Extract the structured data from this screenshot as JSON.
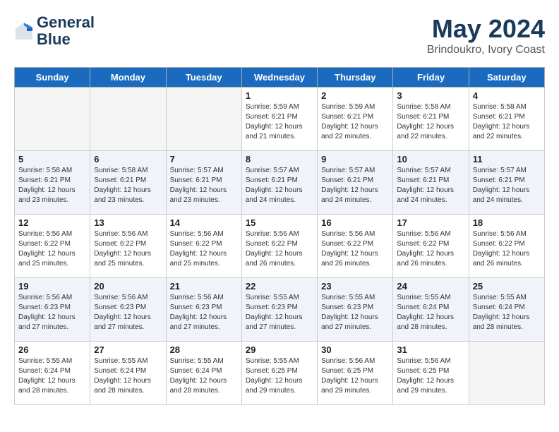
{
  "header": {
    "logo_line1": "General",
    "logo_line2": "Blue",
    "month_year": "May 2024",
    "location": "Brindoukro, Ivory Coast"
  },
  "days_of_week": [
    "Sunday",
    "Monday",
    "Tuesday",
    "Wednesday",
    "Thursday",
    "Friday",
    "Saturday"
  ],
  "weeks": [
    [
      {
        "day": "",
        "info": ""
      },
      {
        "day": "",
        "info": ""
      },
      {
        "day": "",
        "info": ""
      },
      {
        "day": "1",
        "info": "Sunrise: 5:59 AM\nSunset: 6:21 PM\nDaylight: 12 hours\nand 21 minutes."
      },
      {
        "day": "2",
        "info": "Sunrise: 5:59 AM\nSunset: 6:21 PM\nDaylight: 12 hours\nand 22 minutes."
      },
      {
        "day": "3",
        "info": "Sunrise: 5:58 AM\nSunset: 6:21 PM\nDaylight: 12 hours\nand 22 minutes."
      },
      {
        "day": "4",
        "info": "Sunrise: 5:58 AM\nSunset: 6:21 PM\nDaylight: 12 hours\nand 22 minutes."
      }
    ],
    [
      {
        "day": "5",
        "info": "Sunrise: 5:58 AM\nSunset: 6:21 PM\nDaylight: 12 hours\nand 23 minutes."
      },
      {
        "day": "6",
        "info": "Sunrise: 5:58 AM\nSunset: 6:21 PM\nDaylight: 12 hours\nand 23 minutes."
      },
      {
        "day": "7",
        "info": "Sunrise: 5:57 AM\nSunset: 6:21 PM\nDaylight: 12 hours\nand 23 minutes."
      },
      {
        "day": "8",
        "info": "Sunrise: 5:57 AM\nSunset: 6:21 PM\nDaylight: 12 hours\nand 24 minutes."
      },
      {
        "day": "9",
        "info": "Sunrise: 5:57 AM\nSunset: 6:21 PM\nDaylight: 12 hours\nand 24 minutes."
      },
      {
        "day": "10",
        "info": "Sunrise: 5:57 AM\nSunset: 6:21 PM\nDaylight: 12 hours\nand 24 minutes."
      },
      {
        "day": "11",
        "info": "Sunrise: 5:57 AM\nSunset: 6:21 PM\nDaylight: 12 hours\nand 24 minutes."
      }
    ],
    [
      {
        "day": "12",
        "info": "Sunrise: 5:56 AM\nSunset: 6:22 PM\nDaylight: 12 hours\nand 25 minutes."
      },
      {
        "day": "13",
        "info": "Sunrise: 5:56 AM\nSunset: 6:22 PM\nDaylight: 12 hours\nand 25 minutes."
      },
      {
        "day": "14",
        "info": "Sunrise: 5:56 AM\nSunset: 6:22 PM\nDaylight: 12 hours\nand 25 minutes."
      },
      {
        "day": "15",
        "info": "Sunrise: 5:56 AM\nSunset: 6:22 PM\nDaylight: 12 hours\nand 26 minutes."
      },
      {
        "day": "16",
        "info": "Sunrise: 5:56 AM\nSunset: 6:22 PM\nDaylight: 12 hours\nand 26 minutes."
      },
      {
        "day": "17",
        "info": "Sunrise: 5:56 AM\nSunset: 6:22 PM\nDaylight: 12 hours\nand 26 minutes."
      },
      {
        "day": "18",
        "info": "Sunrise: 5:56 AM\nSunset: 6:22 PM\nDaylight: 12 hours\nand 26 minutes."
      }
    ],
    [
      {
        "day": "19",
        "info": "Sunrise: 5:56 AM\nSunset: 6:23 PM\nDaylight: 12 hours\nand 27 minutes."
      },
      {
        "day": "20",
        "info": "Sunrise: 5:56 AM\nSunset: 6:23 PM\nDaylight: 12 hours\nand 27 minutes."
      },
      {
        "day": "21",
        "info": "Sunrise: 5:56 AM\nSunset: 6:23 PM\nDaylight: 12 hours\nand 27 minutes."
      },
      {
        "day": "22",
        "info": "Sunrise: 5:55 AM\nSunset: 6:23 PM\nDaylight: 12 hours\nand 27 minutes."
      },
      {
        "day": "23",
        "info": "Sunrise: 5:55 AM\nSunset: 6:23 PM\nDaylight: 12 hours\nand 27 minutes."
      },
      {
        "day": "24",
        "info": "Sunrise: 5:55 AM\nSunset: 6:24 PM\nDaylight: 12 hours\nand 28 minutes."
      },
      {
        "day": "25",
        "info": "Sunrise: 5:55 AM\nSunset: 6:24 PM\nDaylight: 12 hours\nand 28 minutes."
      }
    ],
    [
      {
        "day": "26",
        "info": "Sunrise: 5:55 AM\nSunset: 6:24 PM\nDaylight: 12 hours\nand 28 minutes."
      },
      {
        "day": "27",
        "info": "Sunrise: 5:55 AM\nSunset: 6:24 PM\nDaylight: 12 hours\nand 28 minutes."
      },
      {
        "day": "28",
        "info": "Sunrise: 5:55 AM\nSunset: 6:24 PM\nDaylight: 12 hours\nand 28 minutes."
      },
      {
        "day": "29",
        "info": "Sunrise: 5:55 AM\nSunset: 6:25 PM\nDaylight: 12 hours\nand 29 minutes."
      },
      {
        "day": "30",
        "info": "Sunrise: 5:56 AM\nSunset: 6:25 PM\nDaylight: 12 hours\nand 29 minutes."
      },
      {
        "day": "31",
        "info": "Sunrise: 5:56 AM\nSunset: 6:25 PM\nDaylight: 12 hours\nand 29 minutes."
      },
      {
        "day": "",
        "info": ""
      }
    ]
  ]
}
